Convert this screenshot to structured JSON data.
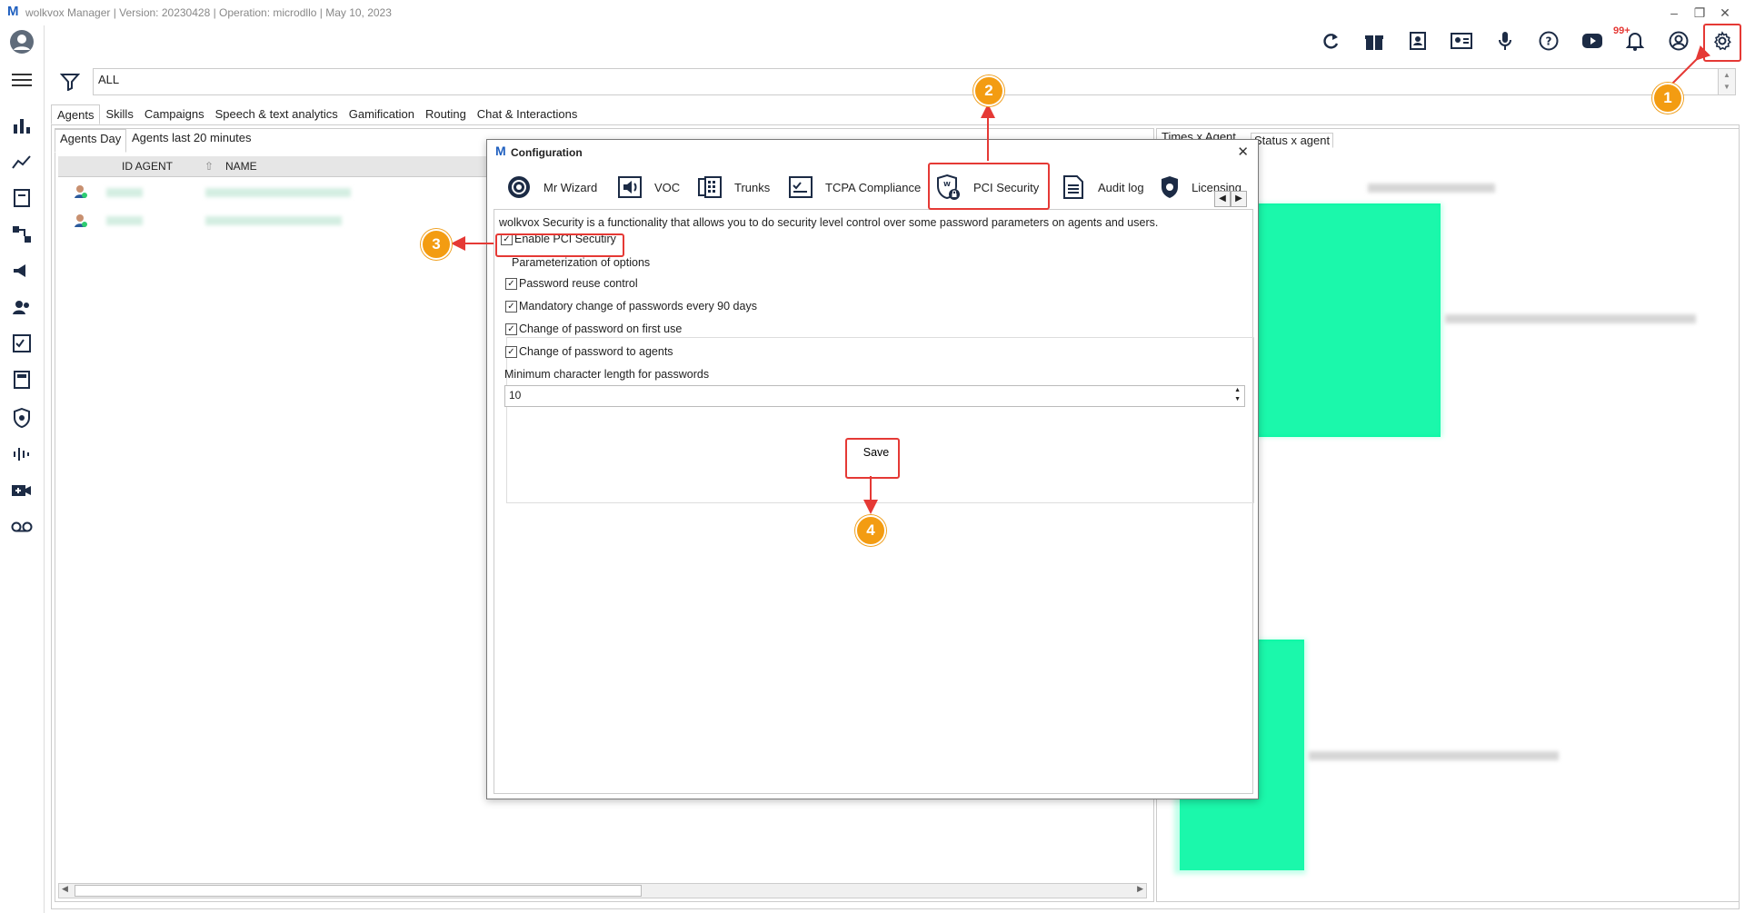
{
  "window": {
    "logo": "M",
    "title": "wolkvox Manager  | Version: 20230428 |  Operation: microdllo | May 10, 2023",
    "minimize": "–",
    "restore": "❐",
    "close": "✕"
  },
  "toolbar": {
    "notification_badge": "99+"
  },
  "filter": {
    "value": "ALL"
  },
  "main_tabs": [
    "Agents",
    "Skills",
    "Campaigns",
    "Speech & text analytics",
    "Gamification",
    "Routing",
    "Chat & Interactions"
  ],
  "sub_tabs": [
    "Agents Day",
    "Agents last 20 minutes"
  ],
  "grid": {
    "columns": [
      "ID AGENT",
      "NAME"
    ]
  },
  "right_tabs": [
    "Times x Agent",
    "Status x agent"
  ],
  "dialog": {
    "logo": "M",
    "title": "Configuration",
    "close": "✕",
    "tabs": [
      "Mr Wizard",
      "VOC",
      "Trunks",
      "TCPA Compliance",
      "PCI Security",
      "Audit log",
      "Licensing"
    ],
    "description": "wolkvox Security is a functionality that allows you to do security level control over some password parameters on agents and users.",
    "enable_label": "Enable PCI Secutiry",
    "group_title": "Parameterization of options",
    "options": [
      "Password reuse control",
      "Mandatory change of passwords every 90 days",
      "Change of password on first use",
      "Change of password to agents"
    ],
    "min_length_label": "Minimum character length for passwords",
    "min_length_value": "10",
    "save_label": "Save"
  },
  "annotations": {
    "badges": [
      "1",
      "2",
      "3",
      "4"
    ],
    "color": "#e53935",
    "badge_color": "#f39c12"
  },
  "colors": {
    "accent": "#1f5fbf",
    "chart_green": "#00f5a0"
  }
}
